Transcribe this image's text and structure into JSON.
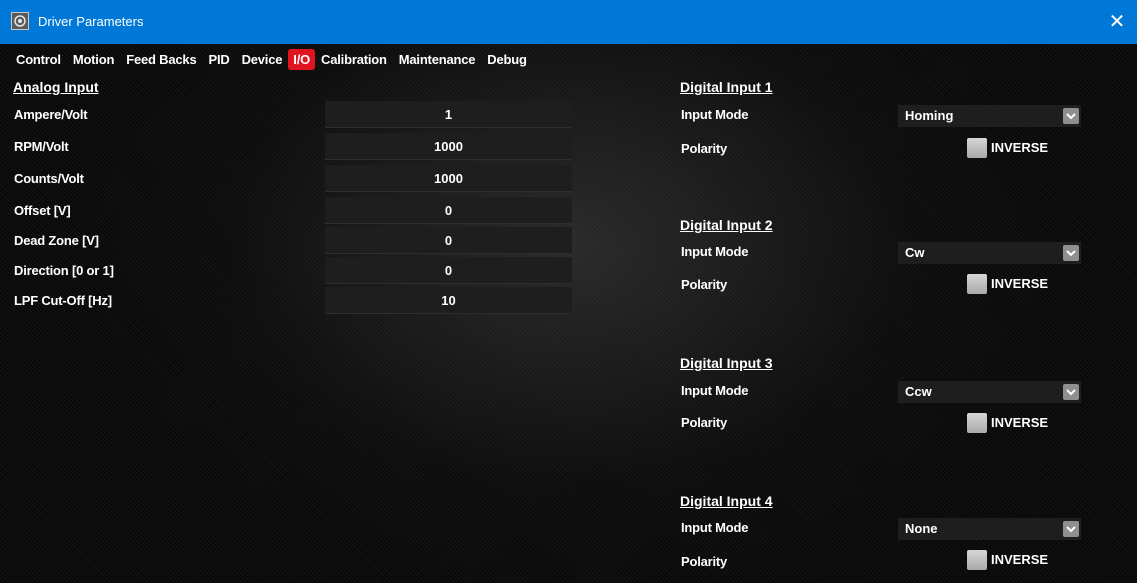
{
  "window": {
    "title": "Driver Parameters",
    "close_glyph": "✕",
    "colors": {
      "titlebar": "#0078d7",
      "active_tab": "#e0141e"
    }
  },
  "tabs": [
    {
      "label": "Control"
    },
    {
      "label": "Motion"
    },
    {
      "label": "Feed Backs"
    },
    {
      "label": "PID"
    },
    {
      "label": "Device"
    },
    {
      "label": "I/O",
      "active": true
    },
    {
      "label": "Calibration"
    },
    {
      "label": "Maintenance"
    },
    {
      "label": "Debug"
    }
  ],
  "analog": {
    "title": "Analog Input",
    "fields": [
      {
        "label": "Ampere/Volt",
        "value": "1"
      },
      {
        "label": "RPM/Volt",
        "value": "1000"
      },
      {
        "label": "Counts/Volt",
        "value": "1000"
      },
      {
        "label": "Offset [V]",
        "value": "0"
      },
      {
        "label": "Dead Zone [V]",
        "value": "0"
      },
      {
        "label": "Direction [0 or 1]",
        "value": "0"
      },
      {
        "label": "LPF Cut-Off [Hz]",
        "value": "10"
      }
    ]
  },
  "digital": [
    {
      "title": "Digital Input 1",
      "mode_label": "Input Mode",
      "mode": "Homing",
      "polarity_label": "Polarity",
      "toggle_label": "INVERSE"
    },
    {
      "title": "Digital Input 2",
      "mode_label": "Input Mode",
      "mode": "Cw",
      "polarity_label": "Polarity",
      "toggle_label": "INVERSE"
    },
    {
      "title": "Digital Input 3",
      "mode_label": "Input Mode",
      "mode": "Ccw",
      "polarity_label": "Polarity",
      "toggle_label": "INVERSE"
    },
    {
      "title": "Digital Input 4",
      "mode_label": "Input Mode",
      "mode": "None",
      "polarity_label": "Polarity",
      "toggle_label": "INVERSE"
    }
  ]
}
